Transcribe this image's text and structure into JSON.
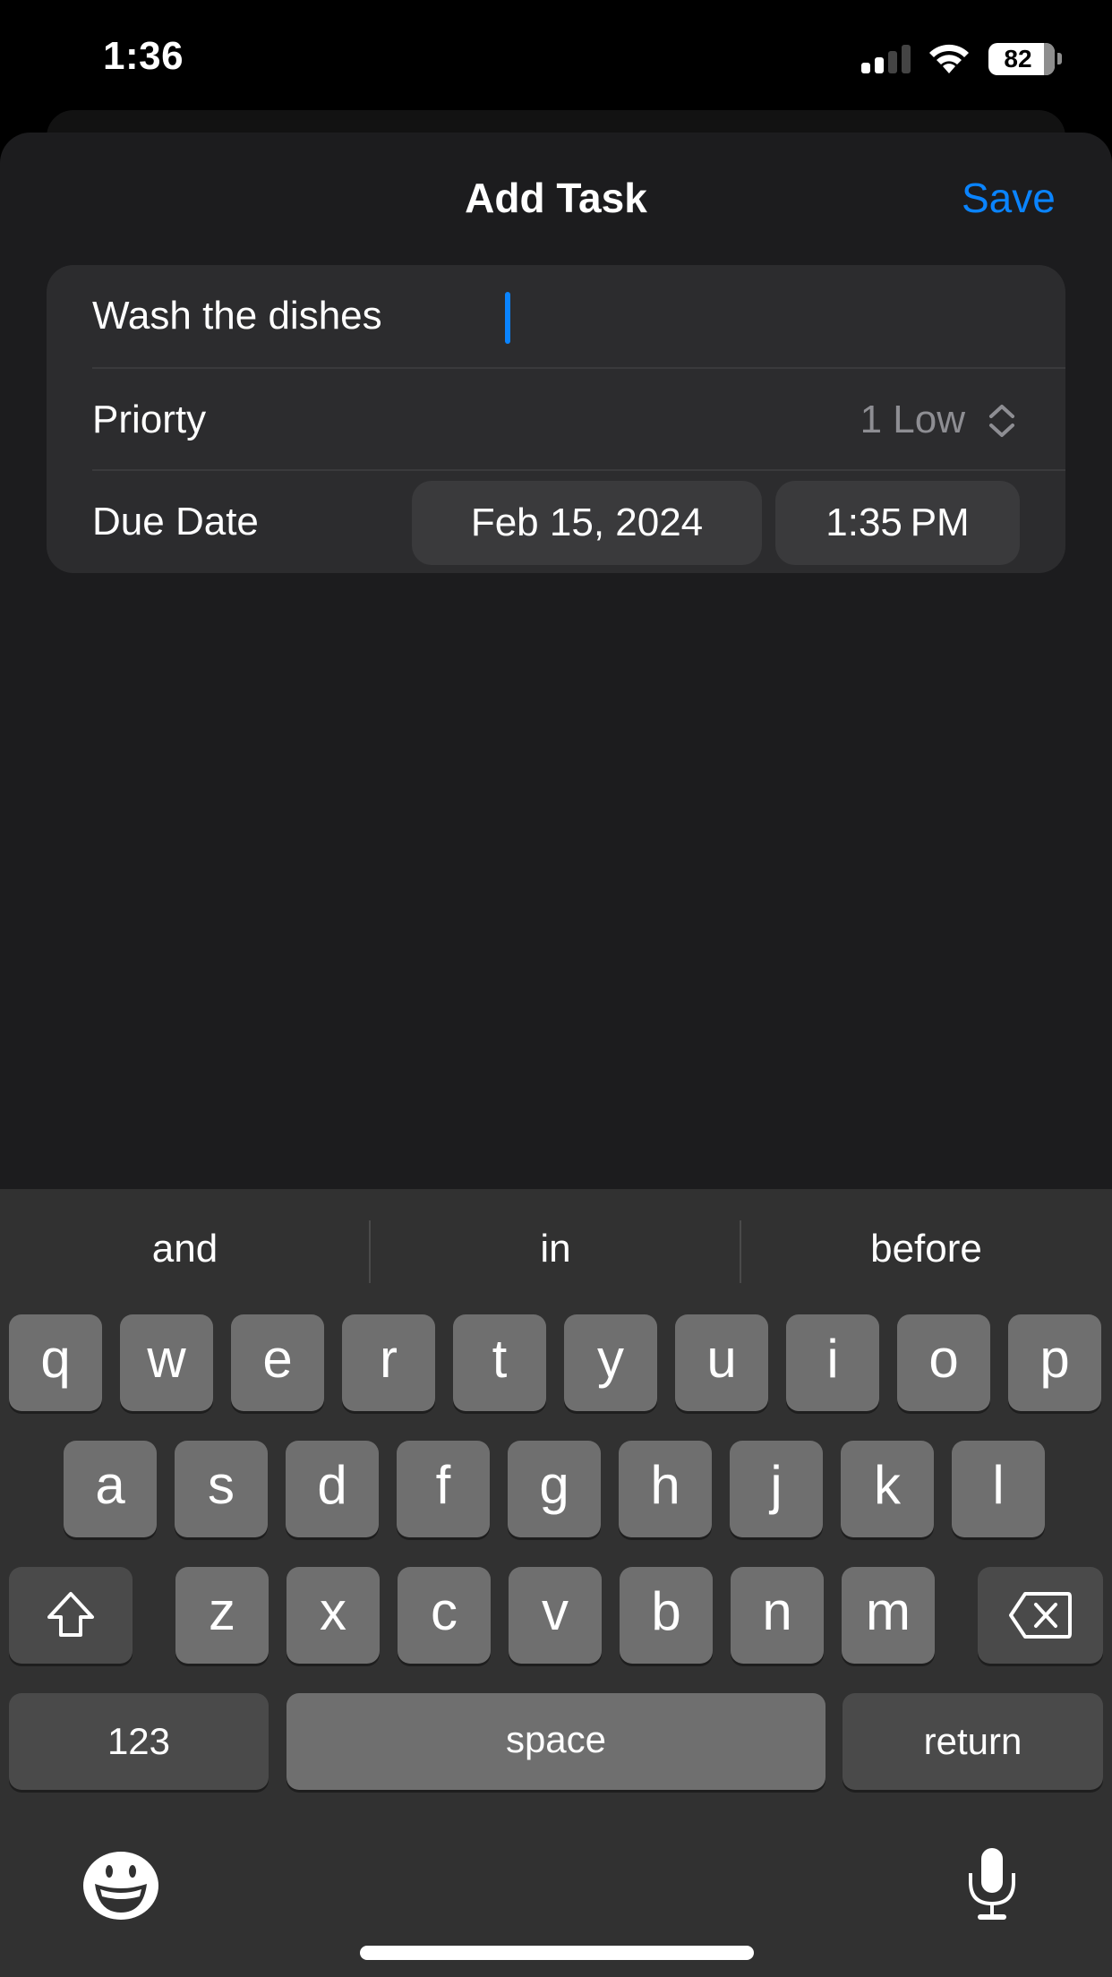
{
  "status_bar": {
    "time": "1:36",
    "signal_bars_active": 2,
    "signal_bars_total": 4,
    "wifi_icon": "wifi-icon",
    "battery_percent": "82"
  },
  "nav": {
    "title": "Add Task",
    "save_label": "Save"
  },
  "form": {
    "task_title_value": "Wash the dishes",
    "priority_label": "Priorty",
    "priority_value": "1 Low",
    "due_date_label": "Due Date",
    "due_date_value": "Feb 15, 2024",
    "due_time_value": "1:35 PM"
  },
  "keyboard": {
    "suggestions": [
      "and",
      "in",
      "before"
    ],
    "row1": [
      "q",
      "w",
      "e",
      "r",
      "t",
      "y",
      "u",
      "i",
      "o",
      "p"
    ],
    "row2": [
      "a",
      "s",
      "d",
      "f",
      "g",
      "h",
      "j",
      "k",
      "l"
    ],
    "row3": [
      "z",
      "x",
      "c",
      "v",
      "b",
      "n",
      "m"
    ],
    "numbers_label": "123",
    "space_label": "space",
    "return_label": "return",
    "shift_icon": "shift-icon",
    "delete_icon": "delete-icon",
    "emoji_icon": "emoji-icon",
    "mic_icon": "microphone-icon"
  },
  "colors": {
    "accent": "#0a84ff",
    "sheet_bg": "#1c1c1e",
    "card_bg": "#2c2c2e",
    "secondary_text": "#8e8e93"
  }
}
